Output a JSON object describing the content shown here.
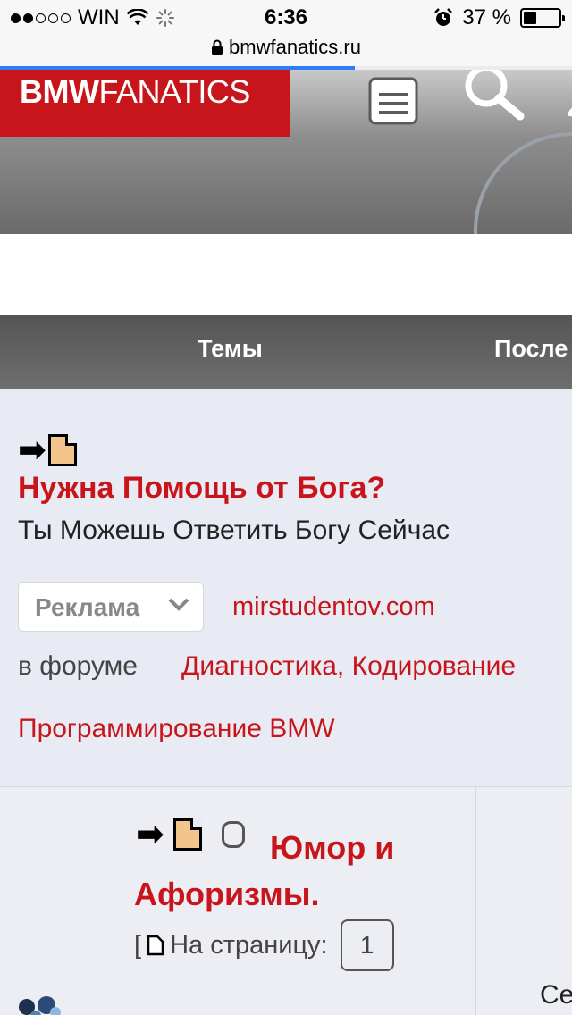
{
  "status_bar": {
    "carrier": "WIN",
    "time": "6:36",
    "battery": "37 %",
    "battery_level": 0.37,
    "signal_bars_filled": 2,
    "signal_bars_total": 5
  },
  "browser": {
    "url": "bmwfanatics.ru",
    "load_progress": 0.62,
    "accent_color": "#2f7df6"
  },
  "header": {
    "logo_bold": "BMW",
    "logo_thin": "FANATICS",
    "brand_color": "#c8151b",
    "icons": [
      "document-icon",
      "search-icon",
      "user-icon"
    ]
  },
  "nav": {
    "tabs": [
      "Темы",
      "После"
    ]
  },
  "ad": {
    "title": "Нужна Помощь от Бога?",
    "description": "Ты Можешь Ответить Богу Сейчас",
    "button_label": "Реклама",
    "domain": "mirstudentov.com",
    "forum_label": "в форуме",
    "forum_link_line1": "Диагностика, Кодирование",
    "forum_link_line2": "Программирование BMW"
  },
  "topic": {
    "title": "Юмор и Афоризмы.",
    "pages_prefix": "[",
    "pages_label": "На страницу:",
    "page_number": "1",
    "cut_column_text": "Се"
  }
}
